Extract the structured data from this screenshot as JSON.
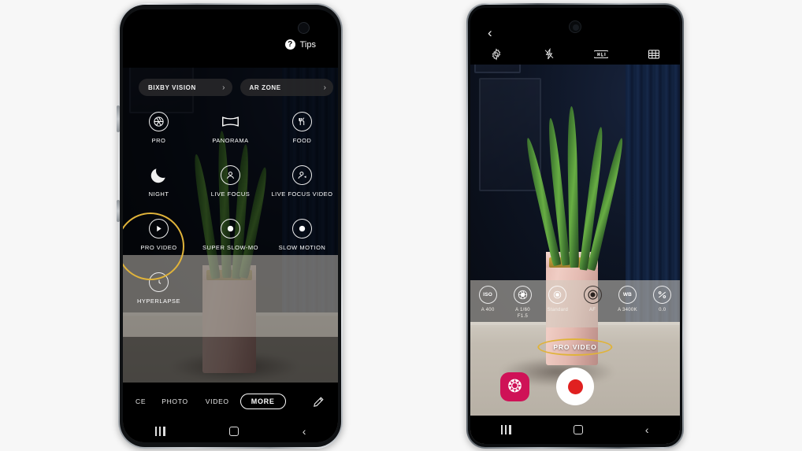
{
  "background_color": "#f7f7f7",
  "accent_highlight_color": "#e0b33a",
  "left_phone": {
    "name": "Galaxy S20 camera MORE modes screen",
    "tips": {
      "label": "Tips",
      "icon": "question-mark-icon"
    },
    "pills": [
      {
        "label": "BIXBY VISION",
        "chevron": "›"
      },
      {
        "label": "AR ZONE",
        "chevron": "›"
      }
    ],
    "modes": [
      {
        "label": "PRO",
        "icon": "aperture-icon",
        "highlighted": false
      },
      {
        "label": "PANORAMA",
        "icon": "panorama-icon",
        "highlighted": false
      },
      {
        "label": "FOOD",
        "icon": "food-icon",
        "highlighted": false
      },
      {
        "label": "NIGHT",
        "icon": "moon-icon",
        "highlighted": false
      },
      {
        "label": "LIVE FOCUS",
        "icon": "person-icon",
        "highlighted": false
      },
      {
        "label": "LIVE FOCUS VIDEO",
        "icon": "person-video-icon",
        "highlighted": false
      },
      {
        "label": "PRO VIDEO",
        "icon": "play-circle-icon",
        "highlighted": true
      },
      {
        "label": "SUPER SLOW-MO",
        "icon": "dot-circle-icon",
        "highlighted": false
      },
      {
        "label": "SLOW MOTION",
        "icon": "dot-circle-icon",
        "highlighted": false
      },
      {
        "label": "HYPERLAPSE",
        "icon": "clock-icon",
        "highlighted": false
      }
    ],
    "tabs": [
      {
        "label": "CE",
        "selected": false,
        "truncated": true
      },
      {
        "label": "PHOTO",
        "selected": false
      },
      {
        "label": "VIDEO",
        "selected": false
      },
      {
        "label": "MORE",
        "selected": true
      }
    ],
    "edit_icon": "pencil-icon",
    "navbar": [
      {
        "icon": "recents-icon"
      },
      {
        "icon": "home-icon"
      },
      {
        "icon": "back-icon"
      }
    ]
  },
  "right_phone": {
    "name": "Galaxy Note 20 Pro Video mode screen",
    "back_icon": "back-chevron-icon",
    "tools": [
      {
        "icon": "settings-gear-icon",
        "label": "Settings"
      },
      {
        "icon": "flash-off-icon",
        "label": "Flash off"
      },
      {
        "icon": "resolution-icon",
        "label": "Resolution"
      },
      {
        "icon": "aspect-grid-icon",
        "label": "Aspect ratio"
      }
    ],
    "pro_controls": [
      {
        "icon": "iso-icon",
        "badge": "ISO",
        "value": "A 400"
      },
      {
        "icon": "shutter-speed-icon",
        "badge": "",
        "value": "A 1/60\nF1.5"
      },
      {
        "icon": "color-tone-icon",
        "badge": "",
        "value": "Standard"
      },
      {
        "icon": "focus-icon",
        "badge": "",
        "value": "AF"
      },
      {
        "icon": "white-balance-icon",
        "badge": "WB",
        "value": "A 3400K"
      },
      {
        "icon": "exposure-value-icon",
        "badge": "",
        "value": "0.0"
      }
    ],
    "mode_label": "PRO VIDEO",
    "gallery_thumb_icon": "flower-thumbnail-icon",
    "record_button": "record-button",
    "navbar": [
      {
        "icon": "recents-icon"
      },
      {
        "icon": "home-icon"
      },
      {
        "icon": "back-icon"
      }
    ]
  }
}
